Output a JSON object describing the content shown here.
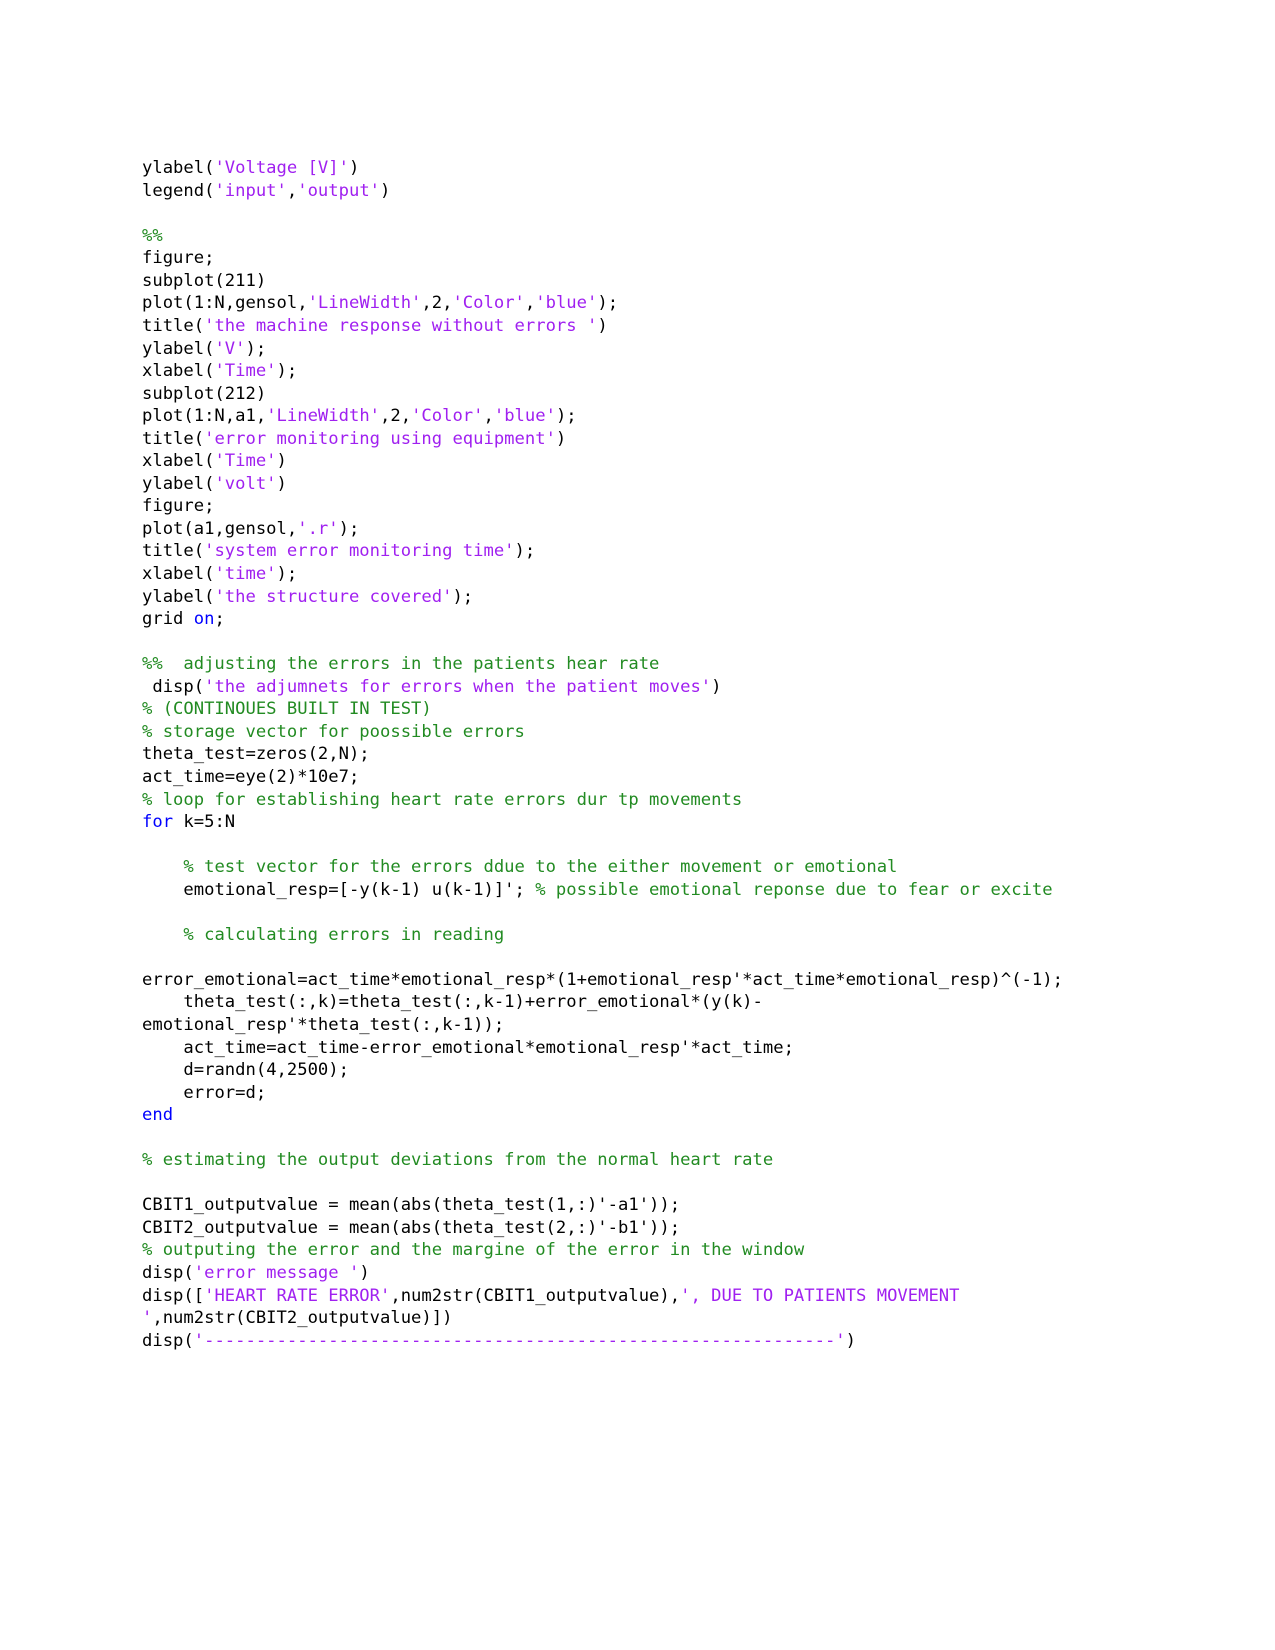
{
  "document": {
    "kind": "source-code-listing",
    "language": "MATLAB",
    "page_background": "#ffffff"
  },
  "syntax_colors": {
    "code": "#000000",
    "string": "#a020f0",
    "comment": "#228b22",
    "keyword": "#0000ff"
  },
  "code": {
    "lines": [
      {
        "id": "l01",
        "tokens": [
          {
            "t": "code",
            "v": "ylabel("
          },
          {
            "t": "string",
            "v": "'Voltage [V]'"
          },
          {
            "t": "code",
            "v": ")"
          }
        ]
      },
      {
        "id": "l02",
        "tokens": [
          {
            "t": "code",
            "v": "legend("
          },
          {
            "t": "string",
            "v": "'input'"
          },
          {
            "t": "code",
            "v": ","
          },
          {
            "t": "string",
            "v": "'output'"
          },
          {
            "t": "code",
            "v": ")"
          }
        ]
      },
      {
        "id": "l03",
        "tokens": []
      },
      {
        "id": "l04",
        "tokens": [
          {
            "t": "comment",
            "v": "%%"
          }
        ]
      },
      {
        "id": "l05",
        "tokens": [
          {
            "t": "code",
            "v": "figure;"
          }
        ]
      },
      {
        "id": "l06",
        "tokens": [
          {
            "t": "code",
            "v": "subplot(211)"
          }
        ]
      },
      {
        "id": "l07",
        "tokens": [
          {
            "t": "code",
            "v": "plot(1:N,gensol,"
          },
          {
            "t": "string",
            "v": "'LineWidth'"
          },
          {
            "t": "code",
            "v": ",2,"
          },
          {
            "t": "string",
            "v": "'Color'"
          },
          {
            "t": "code",
            "v": ","
          },
          {
            "t": "string",
            "v": "'blue'"
          },
          {
            "t": "code",
            "v": ");"
          }
        ]
      },
      {
        "id": "l08",
        "tokens": [
          {
            "t": "code",
            "v": "title("
          },
          {
            "t": "string",
            "v": "'the machine response without errors '"
          },
          {
            "t": "code",
            "v": ")"
          }
        ]
      },
      {
        "id": "l09",
        "tokens": [
          {
            "t": "code",
            "v": "ylabel("
          },
          {
            "t": "string",
            "v": "'V'"
          },
          {
            "t": "code",
            "v": ");"
          }
        ]
      },
      {
        "id": "l10",
        "tokens": [
          {
            "t": "code",
            "v": "xlabel("
          },
          {
            "t": "string",
            "v": "'Time'"
          },
          {
            "t": "code",
            "v": ");"
          }
        ]
      },
      {
        "id": "l11",
        "tokens": [
          {
            "t": "code",
            "v": "subplot(212)"
          }
        ]
      },
      {
        "id": "l12",
        "tokens": [
          {
            "t": "code",
            "v": "plot(1:N,a1,"
          },
          {
            "t": "string",
            "v": "'LineWidth'"
          },
          {
            "t": "code",
            "v": ",2,"
          },
          {
            "t": "string",
            "v": "'Color'"
          },
          {
            "t": "code",
            "v": ","
          },
          {
            "t": "string",
            "v": "'blue'"
          },
          {
            "t": "code",
            "v": ");"
          }
        ]
      },
      {
        "id": "l13",
        "tokens": [
          {
            "t": "code",
            "v": "title("
          },
          {
            "t": "string",
            "v": "'error monitoring using equipment'"
          },
          {
            "t": "code",
            "v": ")"
          }
        ]
      },
      {
        "id": "l14",
        "tokens": [
          {
            "t": "code",
            "v": "xlabel("
          },
          {
            "t": "string",
            "v": "'Time'"
          },
          {
            "t": "code",
            "v": ")"
          }
        ]
      },
      {
        "id": "l15",
        "tokens": [
          {
            "t": "code",
            "v": "ylabel("
          },
          {
            "t": "string",
            "v": "'volt'"
          },
          {
            "t": "code",
            "v": ")"
          }
        ]
      },
      {
        "id": "l16",
        "tokens": [
          {
            "t": "code",
            "v": "figure;"
          }
        ]
      },
      {
        "id": "l17",
        "tokens": [
          {
            "t": "code",
            "v": "plot(a1,gensol,"
          },
          {
            "t": "string",
            "v": "'.r'"
          },
          {
            "t": "code",
            "v": ");"
          }
        ]
      },
      {
        "id": "l18",
        "tokens": [
          {
            "t": "code",
            "v": "title("
          },
          {
            "t": "string",
            "v": "'system error monitoring time'"
          },
          {
            "t": "code",
            "v": ");"
          }
        ]
      },
      {
        "id": "l19",
        "tokens": [
          {
            "t": "code",
            "v": "xlabel("
          },
          {
            "t": "string",
            "v": "'time'"
          },
          {
            "t": "code",
            "v": ");"
          }
        ]
      },
      {
        "id": "l20",
        "tokens": [
          {
            "t": "code",
            "v": "ylabel("
          },
          {
            "t": "string",
            "v": "'the structure covered'"
          },
          {
            "t": "code",
            "v": ");"
          }
        ]
      },
      {
        "id": "l21",
        "tokens": [
          {
            "t": "code",
            "v": "grid "
          },
          {
            "t": "keyword",
            "v": "on"
          },
          {
            "t": "code",
            "v": ";"
          }
        ]
      },
      {
        "id": "l22",
        "tokens": []
      },
      {
        "id": "l23",
        "tokens": [
          {
            "t": "comment",
            "v": "%%  adjusting the errors in the patients hear rate"
          }
        ]
      },
      {
        "id": "l24",
        "tokens": [
          {
            "t": "code",
            "v": " disp("
          },
          {
            "t": "string",
            "v": "'the adjumnets for errors when the patient moves'"
          },
          {
            "t": "code",
            "v": ")"
          }
        ]
      },
      {
        "id": "l25",
        "tokens": [
          {
            "t": "comment",
            "v": "% (CONTINOUES BUILT IN TEST)"
          }
        ]
      },
      {
        "id": "l26",
        "tokens": [
          {
            "t": "comment",
            "v": "% storage vector for poossible errors"
          }
        ]
      },
      {
        "id": "l27",
        "tokens": [
          {
            "t": "code",
            "v": "theta_test=zeros(2,N);"
          }
        ]
      },
      {
        "id": "l28",
        "tokens": [
          {
            "t": "code",
            "v": "act_time=eye(2)*10e7;"
          }
        ]
      },
      {
        "id": "l29",
        "tokens": [
          {
            "t": "comment",
            "v": "% loop for establishing heart rate errors dur tp movements"
          }
        ]
      },
      {
        "id": "l30",
        "tokens": [
          {
            "t": "keyword",
            "v": "for"
          },
          {
            "t": "code",
            "v": " k=5:N"
          }
        ]
      },
      {
        "id": "l31",
        "tokens": []
      },
      {
        "id": "l32",
        "tokens": [
          {
            "t": "comment",
            "v": "    % test vector for the errors ddue to the either movement or emotional"
          }
        ]
      },
      {
        "id": "l33",
        "tokens": [
          {
            "t": "code",
            "v": "    emotional_resp=[-y(k-1) u(k-1)]'; "
          },
          {
            "t": "comment",
            "v": "% possible emotional reponse due to fear or excite"
          }
        ]
      },
      {
        "id": "l34",
        "tokens": []
      },
      {
        "id": "l35",
        "tokens": [
          {
            "t": "comment",
            "v": "    % calculating errors in reading"
          }
        ]
      },
      {
        "id": "l36",
        "tokens": []
      },
      {
        "id": "l37",
        "tokens": [
          {
            "t": "code",
            "v": "error_emotional=act_time*emotional_resp*(1+emotional_resp'*act_time*emotional_resp)^(-1);"
          }
        ]
      },
      {
        "id": "l38",
        "tokens": [
          {
            "t": "code",
            "v": "    theta_test(:,k)=theta_test(:,k-1)+error_emotional*(y(k)-emotional_resp'*theta_test(:,k-1));"
          }
        ]
      },
      {
        "id": "l39",
        "tokens": [
          {
            "t": "code",
            "v": "    act_time=act_time-error_emotional*emotional_resp'*act_time;"
          }
        ]
      },
      {
        "id": "l40",
        "tokens": [
          {
            "t": "code",
            "v": "    d=randn(4,2500);"
          }
        ]
      },
      {
        "id": "l41",
        "tokens": [
          {
            "t": "code",
            "v": "    error=d;"
          }
        ]
      },
      {
        "id": "l42",
        "tokens": [
          {
            "t": "keyword",
            "v": "end"
          }
        ]
      },
      {
        "id": "l43",
        "tokens": []
      },
      {
        "id": "l44",
        "tokens": [
          {
            "t": "comment",
            "v": "% estimating the output deviations from the normal heart rate"
          }
        ]
      },
      {
        "id": "l45",
        "tokens": []
      },
      {
        "id": "l46",
        "tokens": [
          {
            "t": "code",
            "v": "CBIT1_outputvalue = mean(abs(theta_test(1,:)'-a1'));"
          }
        ]
      },
      {
        "id": "l47",
        "tokens": [
          {
            "t": "code",
            "v": "CBIT2_outputvalue = mean(abs(theta_test(2,:)'-b1'));"
          }
        ]
      },
      {
        "id": "l48",
        "tokens": [
          {
            "t": "comment",
            "v": "% outputing the error and the margine of the error in the window"
          }
        ]
      },
      {
        "id": "l49",
        "tokens": [
          {
            "t": "code",
            "v": "disp("
          },
          {
            "t": "string",
            "v": "'error message '"
          },
          {
            "t": "code",
            "v": ")"
          }
        ]
      },
      {
        "id": "l50",
        "tokens": [
          {
            "t": "code",
            "v": "disp(["
          },
          {
            "t": "string",
            "v": "'HEART RATE ERROR'"
          },
          {
            "t": "code",
            "v": ",num2str(CBIT1_outputvalue),"
          },
          {
            "t": "string",
            "v": "', DUE TO PATIENTS MOVEMENT '"
          },
          {
            "t": "code",
            "v": ",num2str(CBIT2_outputvalue)])"
          }
        ]
      },
      {
        "id": "l51",
        "tokens": [
          {
            "t": "code",
            "v": "disp("
          },
          {
            "t": "string",
            "v": "'-------------------------------------------------------------'"
          },
          {
            "t": "code",
            "v": ")"
          }
        ]
      }
    ]
  }
}
